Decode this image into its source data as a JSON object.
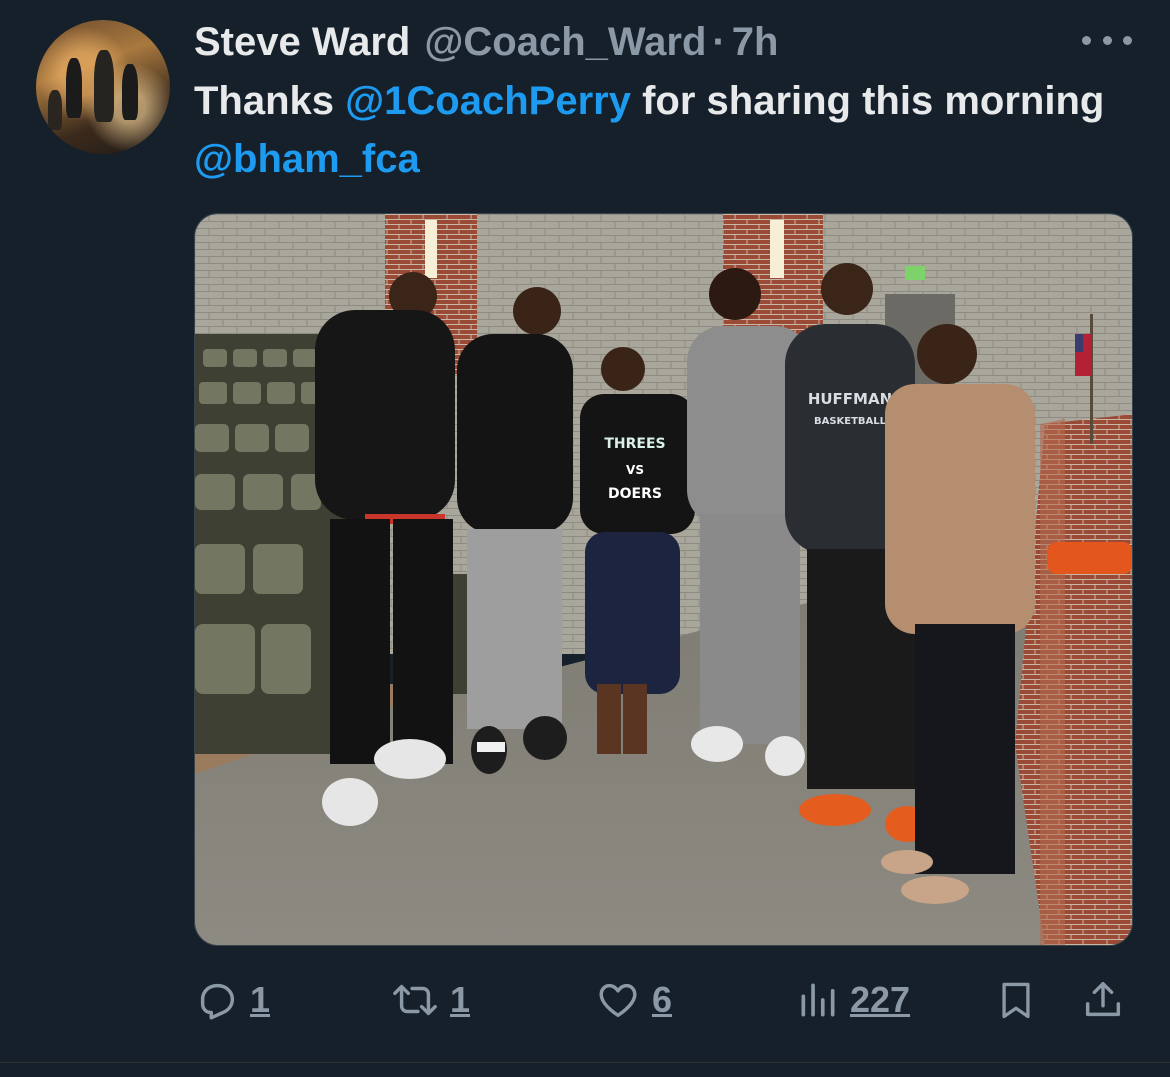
{
  "author": {
    "name": "Steve Ward",
    "handle": "@Coach_Ward",
    "separator": "·",
    "time": "7h"
  },
  "tweet": {
    "text_prefix": "Thanks ",
    "mention_1": "@1CoachPerry",
    "text_middle": " for sharing this morning ",
    "mention_2": "@bham_fca"
  },
  "media": {
    "shirt_text_line1": "THREES",
    "shirt_text_line2": "VS",
    "shirt_text_line3": "DOERS",
    "hoodie_text_line1": "HUFFMAN",
    "hoodie_text_line2": "BASKETBALL"
  },
  "actions": {
    "reply": {
      "icon": "reply-icon",
      "count": "1"
    },
    "retweet": {
      "icon": "retweet-icon",
      "count": "1"
    },
    "like": {
      "icon": "heart-icon",
      "count": "6"
    },
    "views": {
      "icon": "views-icon",
      "count": "227"
    },
    "bookmark": {
      "icon": "bookmark-icon"
    },
    "share": {
      "icon": "share-icon"
    }
  },
  "colors": {
    "background": "#15202b",
    "text": "#e7e9ea",
    "muted": "#8b98a5",
    "accent": "#1d9bf0"
  }
}
